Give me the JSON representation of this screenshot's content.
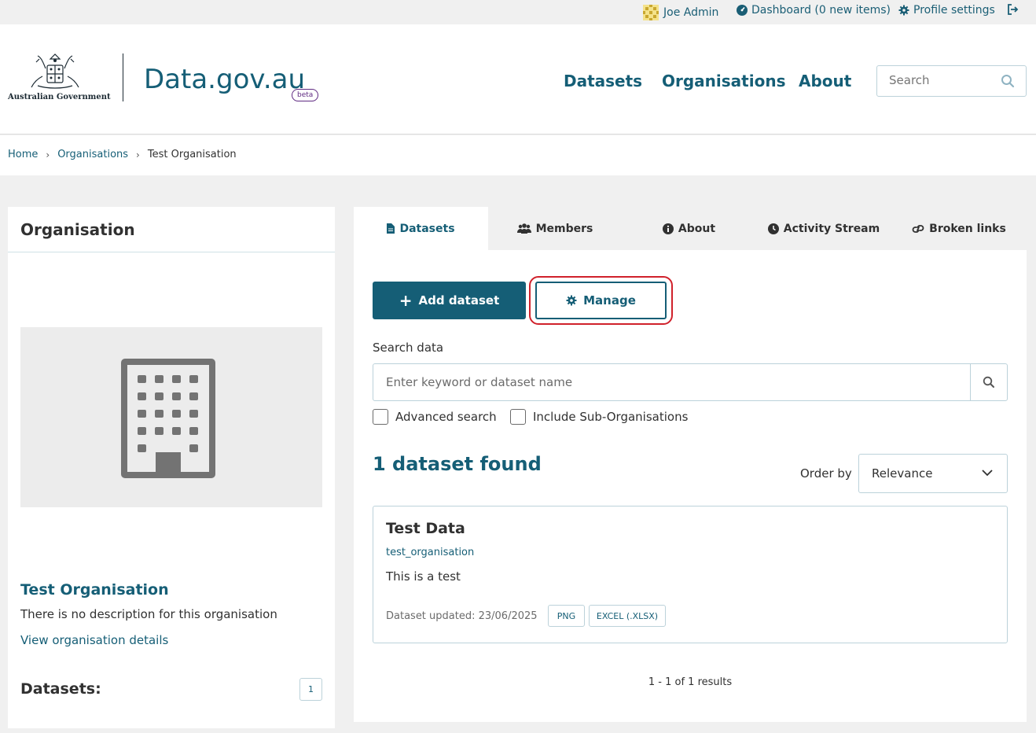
{
  "account_bar": {
    "user_name": "Joe Admin",
    "dashboard_label": "Dashboard (0 new items)",
    "profile_label": "Profile settings"
  },
  "header": {
    "logo_text": "Australian Government",
    "site_title": "Data.gov.au",
    "beta_badge": "beta",
    "nav": [
      "Datasets",
      "Organisations",
      "About"
    ],
    "search_placeholder": "Search"
  },
  "breadcrumb": [
    "Home",
    "Organisations",
    "Test Organisation"
  ],
  "sidebar": {
    "title": "Organisation",
    "org_name": "Test Organisation",
    "description": "There is no description for this organisation",
    "details_link": "View organisation details",
    "datasets_label": "Datasets:",
    "datasets_count": "1"
  },
  "tabs": [
    "Datasets",
    "Members",
    "About",
    "Activity Stream",
    "Broken links"
  ],
  "actions": {
    "add_dataset": "Add dataset",
    "manage": "Manage"
  },
  "search": {
    "label": "Search data",
    "placeholder": "Enter keyword or dataset name",
    "advanced_label": "Advanced search",
    "sub_orgs_label": "Include Sub-Organisations"
  },
  "results": {
    "title": "1 dataset found",
    "order_label": "Order by",
    "order_value": "Relevance",
    "pagination": "1 - 1 of 1 results"
  },
  "dataset": {
    "title": "Test Data",
    "organisation": "test_organisation",
    "description": "This is a test",
    "updated": "Dataset updated: 23/06/2025",
    "formats": [
      "PNG",
      "EXCEL (.XLSX)"
    ]
  },
  "colors": {
    "primary": "#155e76",
    "highlight": "#d0212b",
    "beta": "#5f2a82"
  }
}
